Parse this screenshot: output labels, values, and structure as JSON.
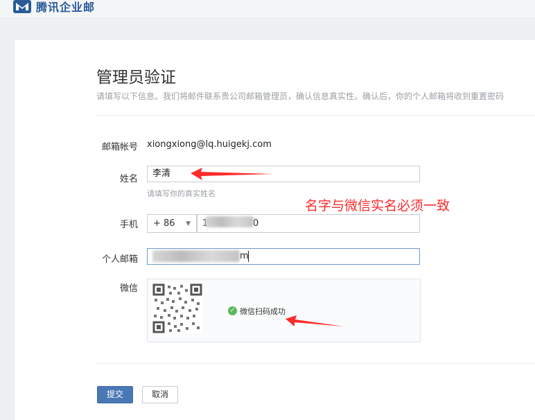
{
  "header": {
    "app_name": "腾讯企业邮",
    "logo_icon": "tencent-exmail-logo-icon"
  },
  "form": {
    "title": "管理员验证",
    "subtitle": "请填写以下信息。我们将邮件联系贵公司邮箱管理员，确认信息真实性。确认后，你的个人邮箱将收到重置密码",
    "email_account": {
      "label": "邮箱帐号",
      "value": "xiongxiong@lq.huigekj.com"
    },
    "name": {
      "label": "姓名",
      "value": "李清",
      "hint": "请填写你的真实姓名"
    },
    "phone": {
      "label": "手机",
      "country_code": "+ 86",
      "value_visible_start": "1",
      "value_visible_end": "0"
    },
    "personal_email": {
      "label": "个人邮箱",
      "value_visible_end": "m"
    },
    "wechat": {
      "label": "微信",
      "status": "微信扫码成功",
      "status_icon": "check-circle-icon"
    },
    "buttons": {
      "submit": "提交",
      "cancel": "取消"
    }
  },
  "annotation": {
    "text": "名字与微信实名必须一致",
    "color": "#ff2a2a"
  },
  "colors": {
    "primary": "#4a78b5",
    "brand": "#2a5b98",
    "success": "#5cb85c"
  }
}
